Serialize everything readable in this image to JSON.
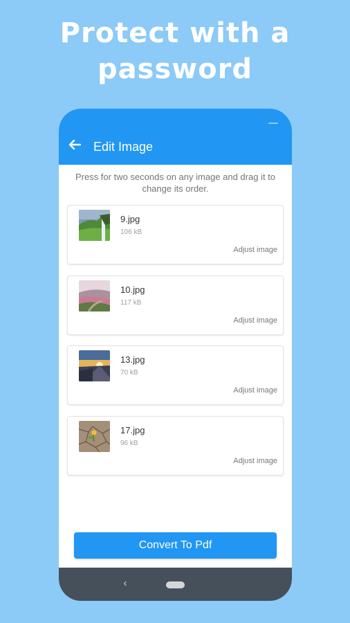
{
  "promo": {
    "title_line1": "Protect with a",
    "title_line2": "password"
  },
  "appbar": {
    "title": "Edit Image",
    "back_icon": "arrow-left-icon"
  },
  "instructions": "Press for two seconds on any image and drag it to change its order.",
  "images": [
    {
      "name": "9.jpg",
      "size": "106 kB",
      "action": "Adjust image",
      "thumbnail": "waterfall-landscape"
    },
    {
      "name": "10.jpg",
      "size": "117 kB",
      "action": "Adjust image",
      "thumbnail": "pink-hills-landscape"
    },
    {
      "name": "13.jpg",
      "size": "70 kB",
      "action": "Adjust image",
      "thumbnail": "sunset-road"
    },
    {
      "name": "17.jpg",
      "size": "96 kB",
      "action": "Adjust image",
      "thumbnail": "flower-cracked-earth"
    }
  ],
  "convert_button": "Convert To Pdf",
  "navbar": {
    "back_glyph": "‹"
  },
  "colors": {
    "background": "#8ccaf7",
    "primary": "#2196f3",
    "navbar": "#45505a"
  }
}
